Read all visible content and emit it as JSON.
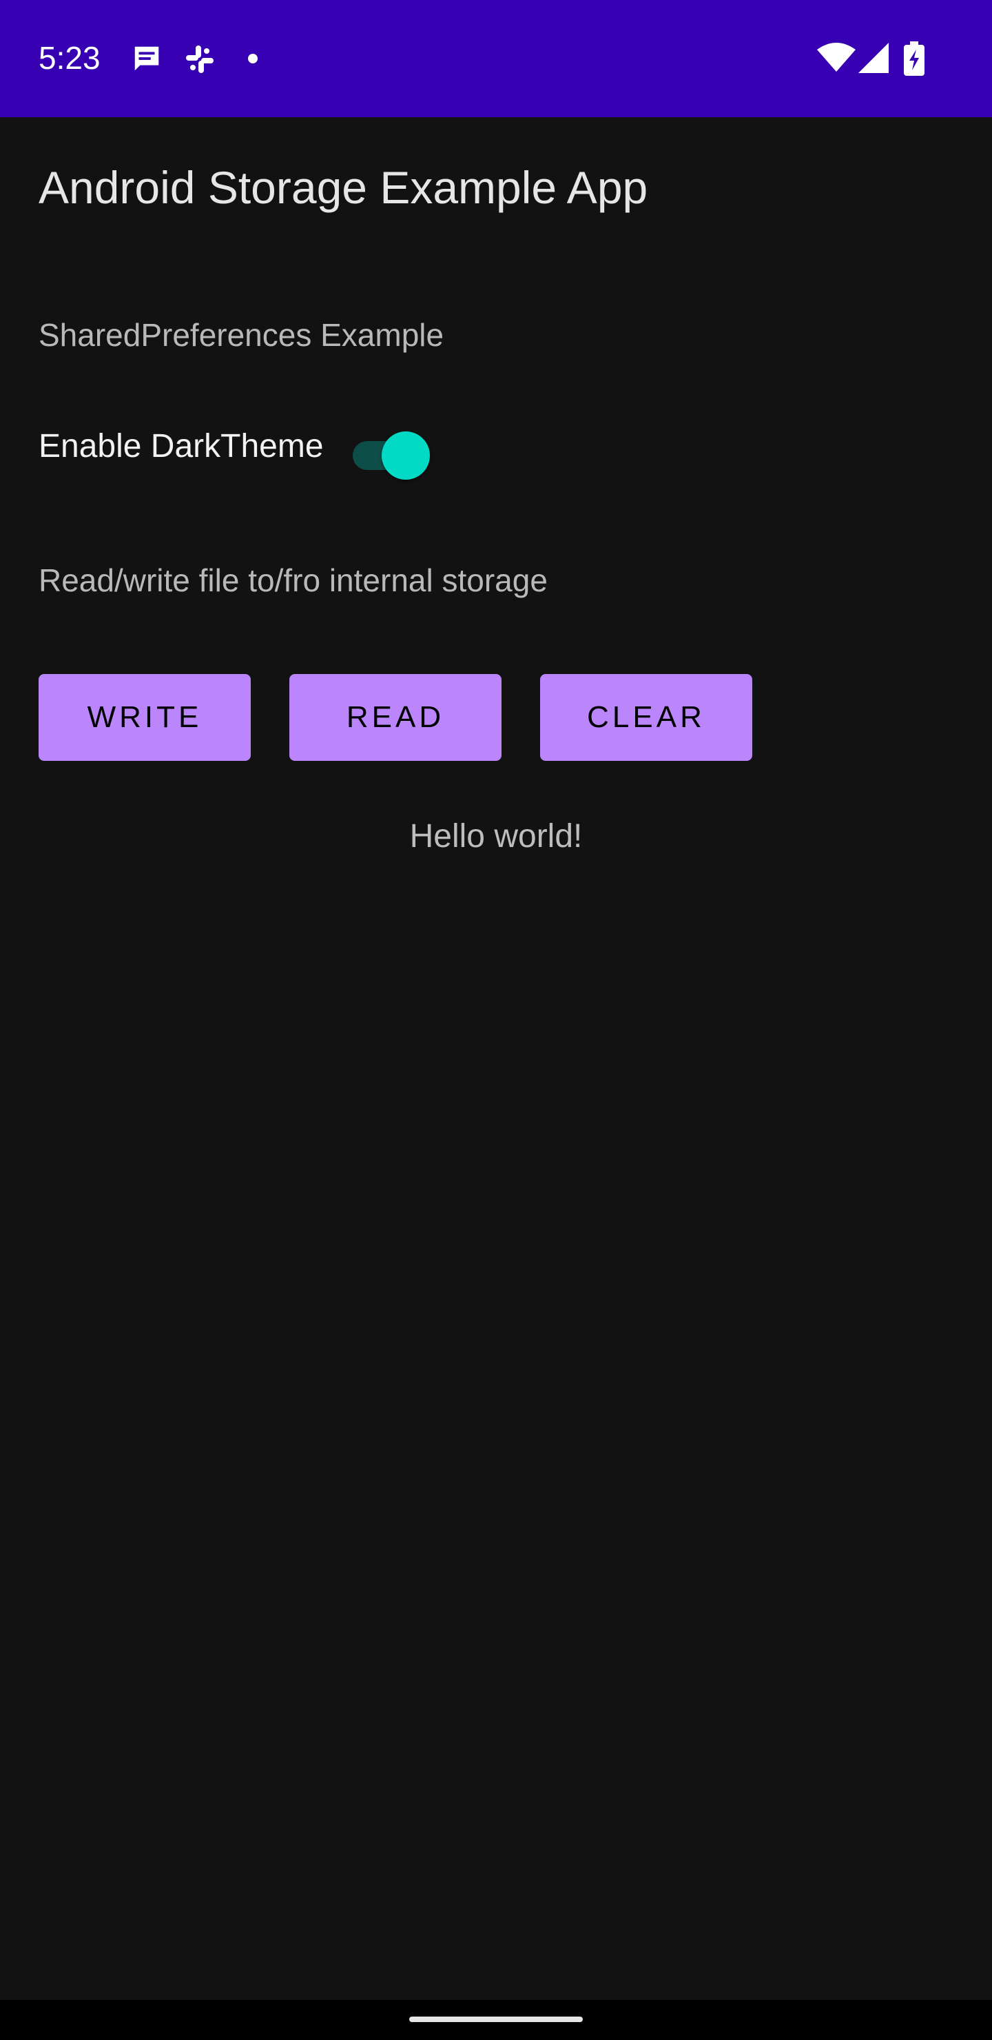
{
  "status_bar": {
    "time": "5:23",
    "background_color": "#3700b3",
    "notification_icons": [
      "message-icon",
      "slack-icon",
      "dot-icon"
    ],
    "system_icons": [
      "wifi-icon",
      "cellular-signal-icon",
      "battery-charging-icon"
    ]
  },
  "app": {
    "title": "Android Storage Example App",
    "background_color": "#121212"
  },
  "shared_prefs": {
    "section_label": "SharedPreferences Example",
    "dark_theme_label": "Enable DarkTheme",
    "dark_theme_enabled": true,
    "switch_thumb_color": "#03dac5"
  },
  "file_storage": {
    "section_label": "Read/write file to/fro internal storage",
    "buttons": {
      "write": "WRITE",
      "read": "READ",
      "clear": "CLEAR"
    },
    "button_color": "#bb86fc",
    "output_text": "Hello world!"
  }
}
